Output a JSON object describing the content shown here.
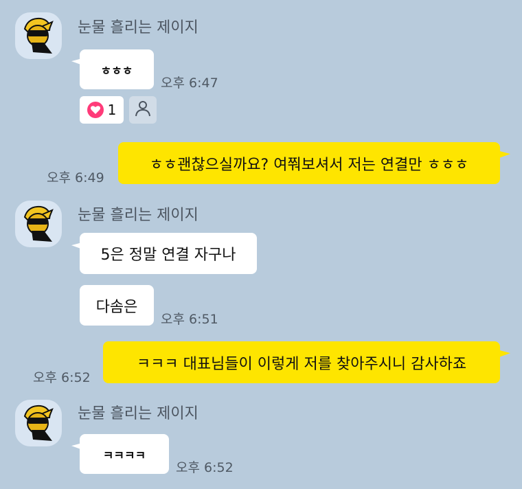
{
  "messages": [
    {
      "sender": "눈물 흘리는 제이지",
      "text": "ㅎㅎㅎ",
      "time": "오후 6:47"
    },
    {
      "text": "ㅎㅎ괜찮으실까요? 여쭤보셔서 저는 연결만 ㅎㅎㅎ",
      "time": "오후 6:49"
    },
    {
      "sender": "눈물 흘리는 제이지",
      "text": "5은 정말 연결 자구나"
    },
    {
      "text": "다솜은",
      "time": "오후 6:51"
    },
    {
      "text": "ㅋㅋㅋ 대표님들이 이렇게 저를 찾아주시니 감사하죠",
      "time": "오후 6:52"
    },
    {
      "sender": "눈물 흘리는 제이지",
      "text": "ㅋㅋㅋㅋ",
      "time": "오후 6:52"
    }
  ],
  "reaction": {
    "count": "1"
  },
  "icons": {
    "reaction": "heart-icon",
    "add_reaction": "person-icon"
  },
  "colors": {
    "background": "#b8cbdc",
    "my_bubble": "#fee500",
    "their_bubble": "#ffffff",
    "heart": "#ff3b79"
  }
}
